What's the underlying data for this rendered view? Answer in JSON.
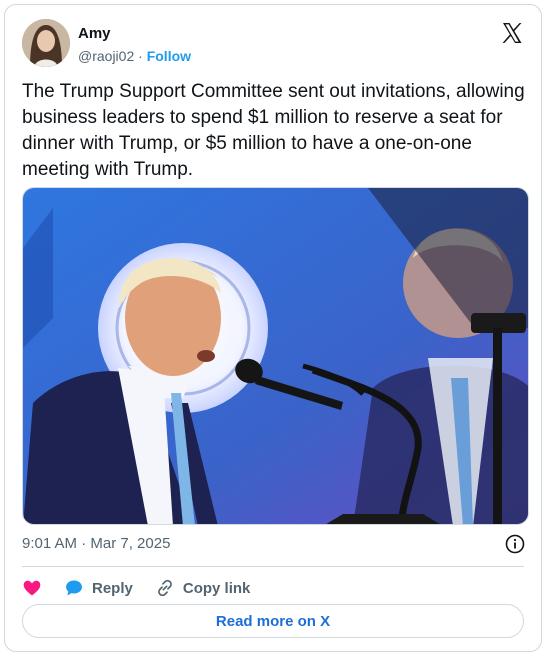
{
  "author": {
    "name": "Amy",
    "handle": "@raoji02",
    "separator": "·",
    "follow_label": "Follow"
  },
  "tweet": {
    "text": "The Trump Support Committee sent out invitations, allowing business leaders to spend $1 million to reserve a seat for dinner with Trump, or $5 million to have a one-on-one meeting with Trump.",
    "timestamp": "9:01 AM · Mar 7, 2025"
  },
  "actions": {
    "reply_label": "Reply",
    "copy_label": "Copy link",
    "read_more_label": "Read more on X"
  },
  "icons": {
    "logo": "x-logo-icon",
    "info": "info-icon",
    "like": "heart-icon",
    "reply": "reply-bubble-icon",
    "copy": "link-icon"
  },
  "colors": {
    "accent": "#1d9bf0",
    "like": "#f91880",
    "read_more": "#1d6fd6"
  }
}
